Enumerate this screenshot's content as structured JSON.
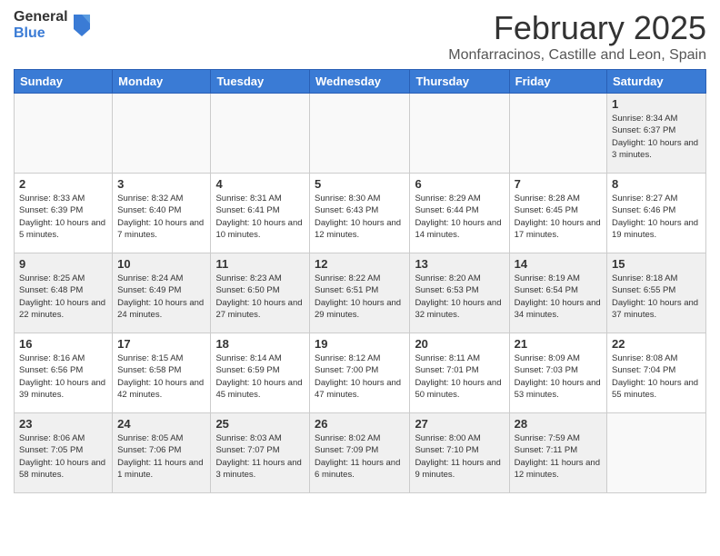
{
  "logo": {
    "general": "General",
    "blue": "Blue"
  },
  "header": {
    "month": "February 2025",
    "location": "Monfarracinos, Castille and Leon, Spain"
  },
  "weekdays": [
    "Sunday",
    "Monday",
    "Tuesday",
    "Wednesday",
    "Thursday",
    "Friday",
    "Saturday"
  ],
  "weeks": [
    [
      {
        "day": "",
        "empty": true
      },
      {
        "day": "",
        "empty": true
      },
      {
        "day": "",
        "empty": true
      },
      {
        "day": "",
        "empty": true
      },
      {
        "day": "",
        "empty": true
      },
      {
        "day": "",
        "empty": true
      },
      {
        "day": "1",
        "sunrise": "8:34 AM",
        "sunset": "6:37 PM",
        "daylight": "10 hours and 3 minutes."
      }
    ],
    [
      {
        "day": "2",
        "sunrise": "8:33 AM",
        "sunset": "6:39 PM",
        "daylight": "10 hours and 5 minutes."
      },
      {
        "day": "3",
        "sunrise": "8:32 AM",
        "sunset": "6:40 PM",
        "daylight": "10 hours and 7 minutes."
      },
      {
        "day": "4",
        "sunrise": "8:31 AM",
        "sunset": "6:41 PM",
        "daylight": "10 hours and 10 minutes."
      },
      {
        "day": "5",
        "sunrise": "8:30 AM",
        "sunset": "6:43 PM",
        "daylight": "10 hours and 12 minutes."
      },
      {
        "day": "6",
        "sunrise": "8:29 AM",
        "sunset": "6:44 PM",
        "daylight": "10 hours and 14 minutes."
      },
      {
        "day": "7",
        "sunrise": "8:28 AM",
        "sunset": "6:45 PM",
        "daylight": "10 hours and 17 minutes."
      },
      {
        "day": "8",
        "sunrise": "8:27 AM",
        "sunset": "6:46 PM",
        "daylight": "10 hours and 19 minutes."
      }
    ],
    [
      {
        "day": "9",
        "sunrise": "8:25 AM",
        "sunset": "6:48 PM",
        "daylight": "10 hours and 22 minutes."
      },
      {
        "day": "10",
        "sunrise": "8:24 AM",
        "sunset": "6:49 PM",
        "daylight": "10 hours and 24 minutes."
      },
      {
        "day": "11",
        "sunrise": "8:23 AM",
        "sunset": "6:50 PM",
        "daylight": "10 hours and 27 minutes."
      },
      {
        "day": "12",
        "sunrise": "8:22 AM",
        "sunset": "6:51 PM",
        "daylight": "10 hours and 29 minutes."
      },
      {
        "day": "13",
        "sunrise": "8:20 AM",
        "sunset": "6:53 PM",
        "daylight": "10 hours and 32 minutes."
      },
      {
        "day": "14",
        "sunrise": "8:19 AM",
        "sunset": "6:54 PM",
        "daylight": "10 hours and 34 minutes."
      },
      {
        "day": "15",
        "sunrise": "8:18 AM",
        "sunset": "6:55 PM",
        "daylight": "10 hours and 37 minutes."
      }
    ],
    [
      {
        "day": "16",
        "sunrise": "8:16 AM",
        "sunset": "6:56 PM",
        "daylight": "10 hours and 39 minutes."
      },
      {
        "day": "17",
        "sunrise": "8:15 AM",
        "sunset": "6:58 PM",
        "daylight": "10 hours and 42 minutes."
      },
      {
        "day": "18",
        "sunrise": "8:14 AM",
        "sunset": "6:59 PM",
        "daylight": "10 hours and 45 minutes."
      },
      {
        "day": "19",
        "sunrise": "8:12 AM",
        "sunset": "7:00 PM",
        "daylight": "10 hours and 47 minutes."
      },
      {
        "day": "20",
        "sunrise": "8:11 AM",
        "sunset": "7:01 PM",
        "daylight": "10 hours and 50 minutes."
      },
      {
        "day": "21",
        "sunrise": "8:09 AM",
        "sunset": "7:03 PM",
        "daylight": "10 hours and 53 minutes."
      },
      {
        "day": "22",
        "sunrise": "8:08 AM",
        "sunset": "7:04 PM",
        "daylight": "10 hours and 55 minutes."
      }
    ],
    [
      {
        "day": "23",
        "sunrise": "8:06 AM",
        "sunset": "7:05 PM",
        "daylight": "10 hours and 58 minutes."
      },
      {
        "day": "24",
        "sunrise": "8:05 AM",
        "sunset": "7:06 PM",
        "daylight": "11 hours and 1 minute."
      },
      {
        "day": "25",
        "sunrise": "8:03 AM",
        "sunset": "7:07 PM",
        "daylight": "11 hours and 3 minutes."
      },
      {
        "day": "26",
        "sunrise": "8:02 AM",
        "sunset": "7:09 PM",
        "daylight": "11 hours and 6 minutes."
      },
      {
        "day": "27",
        "sunrise": "8:00 AM",
        "sunset": "7:10 PM",
        "daylight": "11 hours and 9 minutes."
      },
      {
        "day": "28",
        "sunrise": "7:59 AM",
        "sunset": "7:11 PM",
        "daylight": "11 hours and 12 minutes."
      },
      {
        "day": "",
        "empty": true
      }
    ]
  ]
}
